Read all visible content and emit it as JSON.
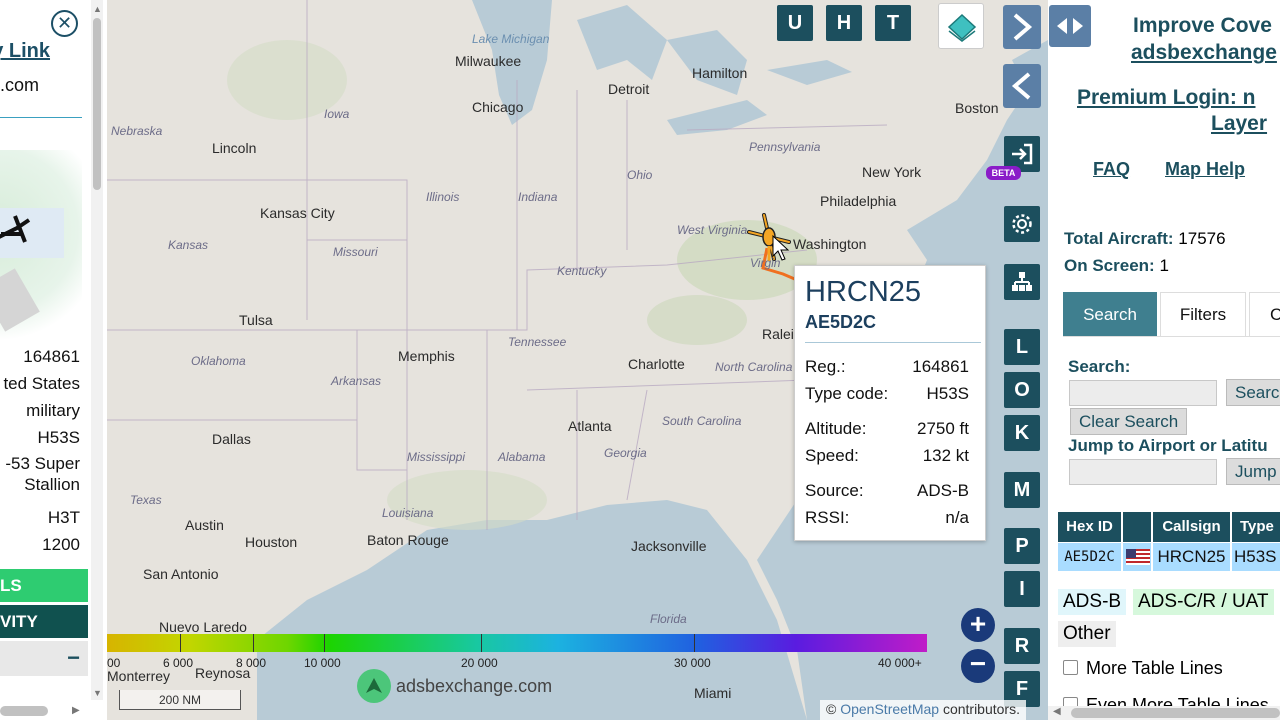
{
  "left_panel": {
    "link_text": "py Link",
    "site_fragment": "e.com",
    "registration": "164861",
    "country": "ted States",
    "category": "military",
    "type_code": "H53S",
    "type_desc_line1": "-53 Super",
    "type_desc_line2": "Stallion",
    "type_class": "H3T",
    "squawk": "1200",
    "btn_details": "LS",
    "btn_activity": "VITY",
    "collapse_symbol": "−"
  },
  "map": {
    "cities": [
      {
        "name": "Milwaukee"
      },
      {
        "name": "Detroit"
      },
      {
        "name": "Hamilton"
      },
      {
        "name": "Chicago"
      },
      {
        "name": "Boston"
      },
      {
        "name": "Lincoln"
      },
      {
        "name": "New York"
      },
      {
        "name": "Kansas City"
      },
      {
        "name": "Philadelphia"
      },
      {
        "name": "Washington"
      },
      {
        "name": "Tulsa"
      },
      {
        "name": "Memphis"
      },
      {
        "name": "Raleigh"
      },
      {
        "name": "Charlotte"
      },
      {
        "name": "Atlanta"
      },
      {
        "name": "Dallas"
      },
      {
        "name": "Austin"
      },
      {
        "name": "Houston"
      },
      {
        "name": "Baton Rouge"
      },
      {
        "name": "Jacksonville"
      },
      {
        "name": "San Antonio"
      },
      {
        "name": "Nuevo Laredo"
      },
      {
        "name": "Reynosa"
      },
      {
        "name": "Monterrey"
      },
      {
        "name": "Miami"
      }
    ],
    "states": [
      "Nebraska",
      "Iowa",
      "Illinois",
      "Indiana",
      "Ohio",
      "Pennsylvania",
      "West Virginia",
      "Virginia",
      "Kansas",
      "Missouri",
      "Kentucky",
      "Oklahoma",
      "Tennessee",
      "Arkansas",
      "North Carolina",
      "South Carolina",
      "Mississippi",
      "Alabama",
      "Georgia",
      "Texas",
      "Louisiana",
      "Florida"
    ],
    "water": [
      "Lake Michigan"
    ],
    "top_buttons": [
      "U",
      "H",
      "T"
    ],
    "side_buttons": [
      "L",
      "O",
      "K",
      "M",
      "P",
      "I",
      "R",
      "F"
    ],
    "beta_badge": "BETA",
    "scale_label": "200 NM",
    "watermark": "adsbexchange.com",
    "attribution_link": "OpenStreetMap",
    "attribution_rest": " contributors."
  },
  "popup": {
    "callsign": "HRCN25",
    "hex": "AE5D2C",
    "rows": [
      {
        "label": "Reg.:",
        "value": "164861"
      },
      {
        "label": "Type code:",
        "value": "H53S"
      },
      {
        "label": "Altitude:",
        "value": "2750 ft"
      },
      {
        "label": "Speed:",
        "value": "132 kt"
      },
      {
        "label": "Source:",
        "value": "ADS-B"
      },
      {
        "label": "RSSI:",
        "value": "n/a"
      }
    ]
  },
  "legend": {
    "labels": [
      "00",
      "6 000",
      "8 000",
      "10 000",
      "20 000",
      "30 000",
      "40 000+"
    ]
  },
  "right_panel": {
    "improve_line1": "Improve Cove",
    "improve_line2": "adsbexchange",
    "premium_line1": "Premium Login: n",
    "premium_line2": "Layer",
    "faq": "FAQ",
    "map_help": "Map Help",
    "total_label": "Total Aircraft:",
    "total_value": "17576",
    "onscreen_label": "On Screen:",
    "onscreen_value": "1",
    "tabs": [
      "Search",
      "Filters",
      "C"
    ],
    "search_label": "Search:",
    "search_button": "Searc",
    "clear_button": "Clear Search",
    "jump_label": "Jump to Airport or Latitu",
    "jump_button": "Jump",
    "table_headers": [
      "Hex ID",
      "",
      "Callsign",
      "Type"
    ],
    "table_row": {
      "hex": "AE5D2C",
      "callsign": "HRCN25",
      "type": "H53S"
    },
    "source_tags": [
      "ADS-B",
      "ADS-C/R / UAT",
      "Other"
    ],
    "more_lines": "More Table Lines",
    "even_more": "Even More Table Lines"
  },
  "colors": {
    "accent": "#1c4f5e",
    "link": "#1c4f66",
    "aircraft": "#f5a623",
    "track": "#f07020",
    "row_highlight": "#a9dcff",
    "green_button": "#2ecc71",
    "dark_button": "#10514f"
  }
}
